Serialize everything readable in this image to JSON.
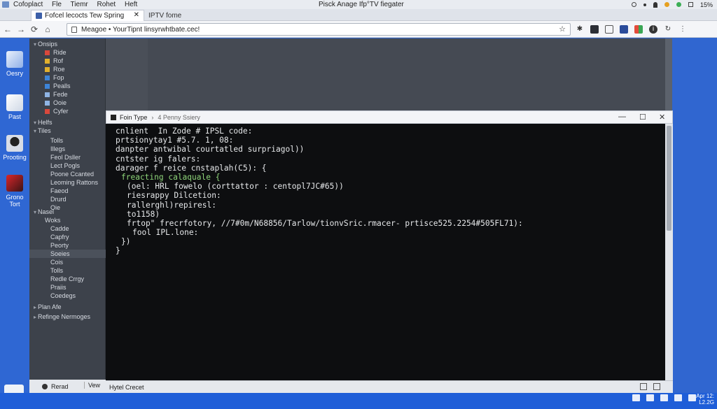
{
  "titlebar": {
    "menu": [
      "Cofoplact",
      "Fle",
      "Tiemr",
      "Rohet",
      "Heft"
    ],
    "title": "Pisck Anage Ifp°TV fiegater",
    "zoom": "15%"
  },
  "tabs": [
    {
      "label": "Fofcel lecocts Tew Spring",
      "close": "✕"
    },
    {
      "label": "IPTV fome"
    }
  ],
  "address": {
    "url": "Meagoe • YourTipnt linsyrwhtbate.cec!",
    "star": "☆"
  },
  "dock": [
    {
      "label": "Oesry"
    },
    {
      "label": "Past"
    },
    {
      "label": "Prooting"
    },
    {
      "label": "Grono Tort"
    }
  ],
  "tree": [
    {
      "label": "Onsips",
      "level": 0,
      "caret": "▾"
    },
    {
      "label": "Ride",
      "level": 1,
      "icon": "f-red"
    },
    {
      "label": "Rof",
      "level": 1,
      "icon": "f-yel"
    },
    {
      "label": "Roe",
      "level": 1,
      "icon": "f-yel"
    },
    {
      "label": "Fop",
      "level": 1,
      "icon": "f-blu"
    },
    {
      "label": "Pealls",
      "level": 1,
      "icon": "f-blu"
    },
    {
      "label": "Fede",
      "level": 1,
      "icon": "f-lt"
    },
    {
      "label": "Ooie",
      "level": 1,
      "icon": "f-lt"
    },
    {
      "label": "Cyfer",
      "level": 1,
      "icon": "f-red"
    },
    {
      "label": "Helfs",
      "level": 0,
      "caret": "▾"
    },
    {
      "label": "Tiles",
      "level": 0,
      "caret": "▾"
    },
    {
      "label": "Tolls",
      "level": 2
    },
    {
      "label": "Illegs",
      "level": 2
    },
    {
      "label": "Feol Dsller",
      "level": 2
    },
    {
      "label": "Lect Pogls",
      "level": 2
    },
    {
      "label": "Poone Ccanted",
      "level": 2
    },
    {
      "label": "Leoming Rattons",
      "level": 2
    },
    {
      "label": "Faeod",
      "level": 2
    },
    {
      "label": "Drurd",
      "level": 2
    },
    {
      "label": "Oie",
      "level": 2
    },
    {
      "label": "Nasel",
      "level": 0,
      "caret": "▾"
    },
    {
      "label": "Woks",
      "level": 1
    },
    {
      "label": "Cadde",
      "level": 2
    },
    {
      "label": "Capfry",
      "level": 2
    },
    {
      "label": "Peorty",
      "level": 2
    },
    {
      "label": "Soeies",
      "level": 2,
      "selected": true
    },
    {
      "label": "Cois",
      "level": 2
    },
    {
      "label": "Tolls",
      "level": 2
    },
    {
      "label": "Redle Crrgy",
      "level": 2
    },
    {
      "label": "Praiis",
      "level": 2
    },
    {
      "label": "Coedegs",
      "level": 2
    },
    {
      "label": "Plan Afe",
      "level": 0,
      "caret": "▸"
    },
    {
      "label": "Refinge Nermoges",
      "level": 0,
      "caret": "▸"
    }
  ],
  "tree_footer": {
    "read": "Rerad",
    "view": "Vew"
  },
  "terminal": {
    "title": "Foin Type",
    "subtitle": "4 Penny Ssiery",
    "lines": [
      {
        "text": "cnlient  In Zode # IPSL code:",
        "indent": 0
      },
      {
        "text": "prtsionytay1 #5.7. 1, 08:",
        "indent": 0
      },
      {
        "text": "danpter antwibal courtatled surpriagol))",
        "indent": 0
      },
      {
        "text": "cntster ig falers:",
        "indent": 0
      },
      {
        "text": "darager f reice cnstaplah(C5): {",
        "indent": 0
      },
      {
        "text": "freacting calaquale {",
        "indent": 1,
        "green": true
      },
      {
        "text": "(oel: HRL fowelo (corttattor : centopl7JC#65))",
        "indent": 2
      },
      {
        "text": "riesrappy Dilcetion:",
        "indent": 2
      },
      {
        "text": "rallerghl)repiresl:",
        "indent": 2
      },
      {
        "text": "to1158)",
        "indent": 2
      },
      {
        "text": "frtop\" frecrfotory, //7#0m/N68856/Tarlow/tionvSric.rmacer- prtisce525.2254#505FL71):",
        "indent": 2
      },
      {
        "text": "fool IPL.lone:",
        "indent": 3
      },
      {
        "text": "})",
        "indent": 1
      },
      {
        "text": "}",
        "indent": 0
      }
    ]
  },
  "status": {
    "text": "Hytel Crecet"
  },
  "taskbar": {
    "time": "Apr 12:",
    "date": "L2.2G"
  }
}
